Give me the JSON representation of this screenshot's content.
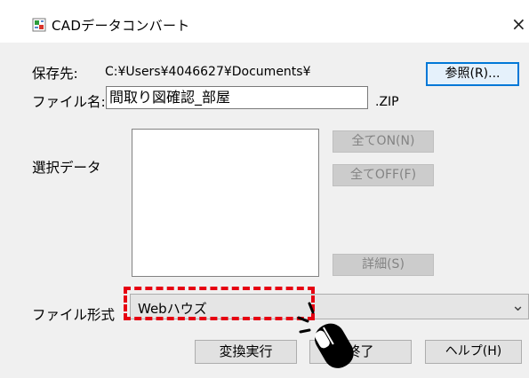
{
  "window": {
    "title": "CADデータコンバート",
    "close_glyph": "×"
  },
  "form": {
    "save_label": "保存先:",
    "save_path": "C:¥Users¥4046627¥Documents¥",
    "browse_label": "参照(R)...",
    "filename_label": "ファイル名:",
    "filename_value": "間取り図確認_部屋",
    "extension": ".ZIP",
    "select_data_label": "選択データ",
    "all_on_label": "全てON(N)",
    "all_off_label": "全てOFF(F)",
    "details_label": "詳細(S)",
    "file_format_label": "ファイル形式",
    "file_format_value": "Webハウズ",
    "dropdown_glyph": "⌄"
  },
  "footer": {
    "convert_label": "変換実行",
    "finish_label": "終了",
    "help_label": "ヘルプ(H)"
  },
  "colors": {
    "highlight": "#e60012",
    "default_button_border": "#0078d7"
  },
  "icons": [
    "app-icon",
    "close-icon",
    "chevron-down-icon",
    "mouse-cursor-icon"
  ]
}
